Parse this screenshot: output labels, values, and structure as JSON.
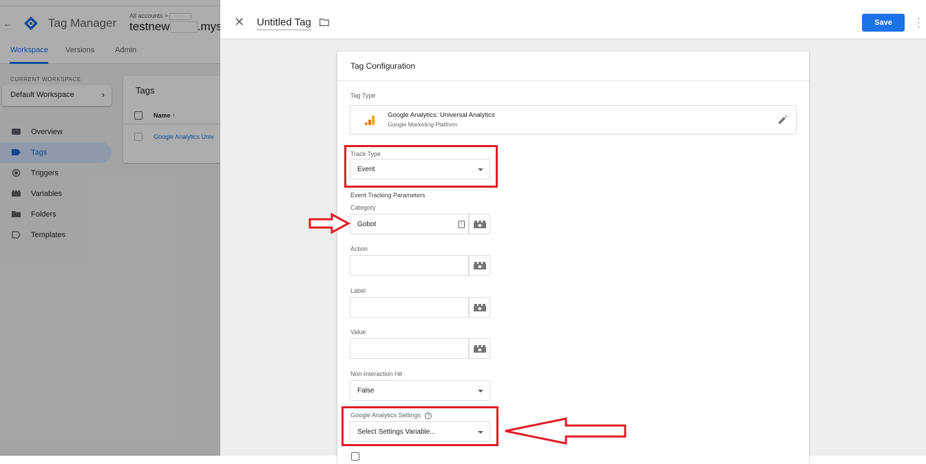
{
  "app": {
    "product_name": "Tag Manager",
    "account_crumb": "All accounts >",
    "container_prefix": "testnew",
    "container_suffix": ".mys",
    "tabs": [
      {
        "label": "Workspace",
        "active": true
      },
      {
        "label": "Versions",
        "active": false
      },
      {
        "label": "Admin",
        "active": false
      }
    ],
    "current_workspace_label": "CURRENT WORKSPACE",
    "workspace_name": "Default Workspace",
    "nav": [
      {
        "label": "Overview",
        "icon": "overview-icon"
      },
      {
        "label": "Tags",
        "icon": "tag-icon",
        "active": true
      },
      {
        "label": "Triggers",
        "icon": "trigger-icon"
      },
      {
        "label": "Variables",
        "icon": "variables-icon"
      },
      {
        "label": "Folders",
        "icon": "folder-icon"
      },
      {
        "label": "Templates",
        "icon": "template-icon"
      }
    ],
    "tags_card": {
      "title": "Tags",
      "col_name": "Name ↑",
      "row_link": "Google Analytics Univ"
    }
  },
  "panel": {
    "tag_name": "Untitled Tag",
    "save_label": "Save",
    "config_title": "Tag Configuration",
    "tag_type_label": "Tag Type",
    "tag_type_name": "Google Analytics: Universal Analytics",
    "tag_type_vendor": "Google Marketing Platform",
    "track_type_label": "Track Type",
    "track_type_value": "Event",
    "event_params_label": "Event Tracking Parameters",
    "category_label": "Category",
    "category_value": "Gobot",
    "action_label": "Action",
    "action_value": "",
    "label_label": "Label",
    "label_value": "",
    "value_label": "Value",
    "value_value": "",
    "non_interaction_label": "Non-Interaction Hit",
    "non_interaction_value": "False",
    "ga_settings_label": "Google Analytics Settings",
    "ga_settings_value": "Select Settings Variable..."
  },
  "colors": {
    "accent": "#1a73e8",
    "annotation_red": "#e01b24",
    "ga_orange": "#f9ab00",
    "ga_dark_orange": "#e37400"
  }
}
